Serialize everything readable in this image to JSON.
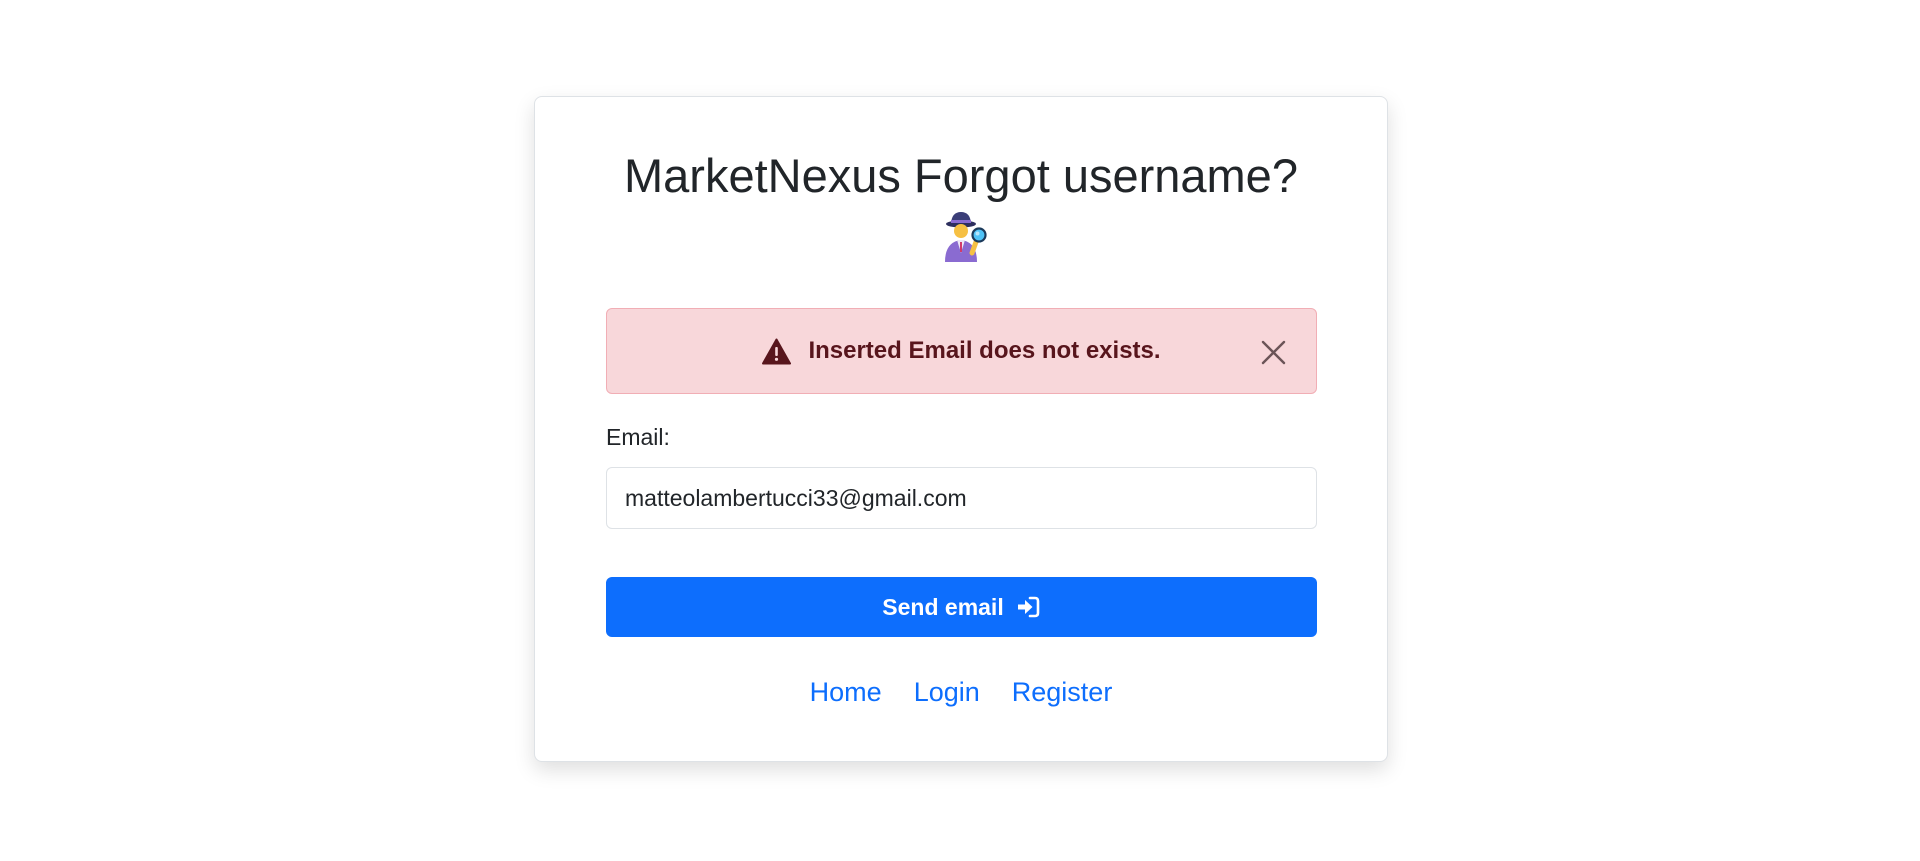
{
  "page": {
    "title": "MarketNexus Forgot username?",
    "icon": "woman-detective-emoji"
  },
  "alert": {
    "icon": "warning-triangle-icon",
    "message": "Inserted Email does not exists.",
    "close_icon": "close-icon",
    "background_color": "#f8d7da",
    "text_color": "#58151c"
  },
  "form": {
    "email_label": "Email:",
    "email_value": "matteolambertucci33@gmail.com",
    "submit_label": "Send email",
    "submit_icon": "sign-in-arrow-icon",
    "submit_color": "#0d6efd"
  },
  "nav": {
    "links": [
      "Home",
      "Login",
      "Register"
    ]
  }
}
